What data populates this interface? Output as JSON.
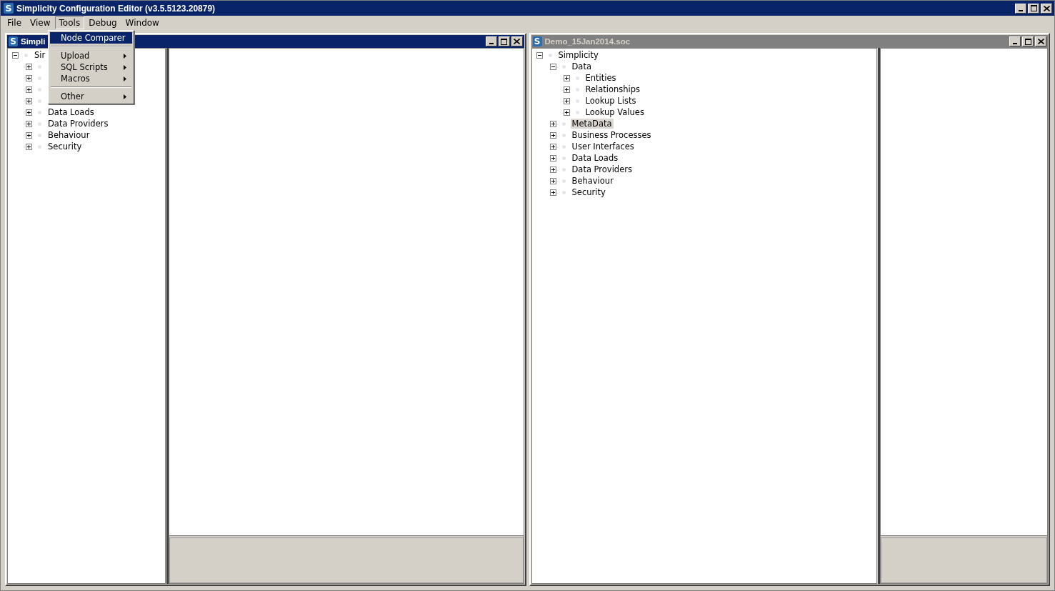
{
  "window": {
    "icon_letter": "S",
    "title": "Simplicity Configuration Editor (v3.5.5123.20879)"
  },
  "menu_bar": [
    {
      "label": "File",
      "selected": false
    },
    {
      "label": "View",
      "selected": false
    },
    {
      "label": "Tools",
      "selected": true
    },
    {
      "label": "Debug",
      "selected": false
    },
    {
      "label": "Window",
      "selected": false
    }
  ],
  "open_menu": {
    "items": [
      {
        "kind": "item",
        "label": "Node Comparer",
        "selected": true,
        "submenu": false
      },
      {
        "kind": "separator"
      },
      {
        "kind": "item",
        "label": "Upload",
        "selected": false,
        "submenu": true
      },
      {
        "kind": "item",
        "label": "SQL Scripts",
        "selected": false,
        "submenu": true
      },
      {
        "kind": "item",
        "label": "Macros",
        "selected": false,
        "submenu": true
      },
      {
        "kind": "separator"
      },
      {
        "kind": "item",
        "label": "Other",
        "selected": false,
        "submenu": true
      }
    ]
  },
  "documents": [
    {
      "icon_letter": "S",
      "title": "Simpli",
      "active": true,
      "tree": [
        {
          "label": "Sir",
          "expanded": true,
          "selected": false,
          "children": [
            {
              "expanded": false
            },
            {
              "expanded": false
            },
            {
              "expanded": false
            },
            {
              "expanded": false
            },
            {
              "label": "Data Loads",
              "expanded": false,
              "selected": false
            },
            {
              "label": "Data Providers",
              "expanded": false,
              "selected": false
            },
            {
              "label": "Behaviour",
              "expanded": false,
              "selected": false
            },
            {
              "label": "Security",
              "expanded": false,
              "selected": false
            }
          ]
        }
      ]
    },
    {
      "icon_letter": "S",
      "title": "Demo_15Jan2014.soc",
      "active": false,
      "tree": [
        {
          "label": "Simplicity",
          "expanded": true,
          "selected": false,
          "children": [
            {
              "label": "Data",
              "expanded": true,
              "selected": false,
              "children": [
                {
                  "label": "Entities",
                  "expanded": false,
                  "selected": false
                },
                {
                  "label": "Relationships",
                  "expanded": false,
                  "selected": false
                },
                {
                  "label": "Lookup Lists",
                  "expanded": false,
                  "selected": false
                },
                {
                  "label": "Lookup Values",
                  "expanded": false,
                  "selected": false
                }
              ]
            },
            {
              "label": "MetaData",
              "expanded": false,
              "selected": true
            },
            {
              "label": "Business Processes",
              "expanded": false,
              "selected": false
            },
            {
              "label": "User Interfaces",
              "expanded": false,
              "selected": false
            },
            {
              "label": "Data Loads",
              "expanded": false,
              "selected": false
            },
            {
              "label": "Data Providers",
              "expanded": false,
              "selected": false
            },
            {
              "label": "Behaviour",
              "expanded": false,
              "selected": false
            },
            {
              "label": "Security",
              "expanded": false,
              "selected": false
            }
          ]
        }
      ]
    }
  ]
}
